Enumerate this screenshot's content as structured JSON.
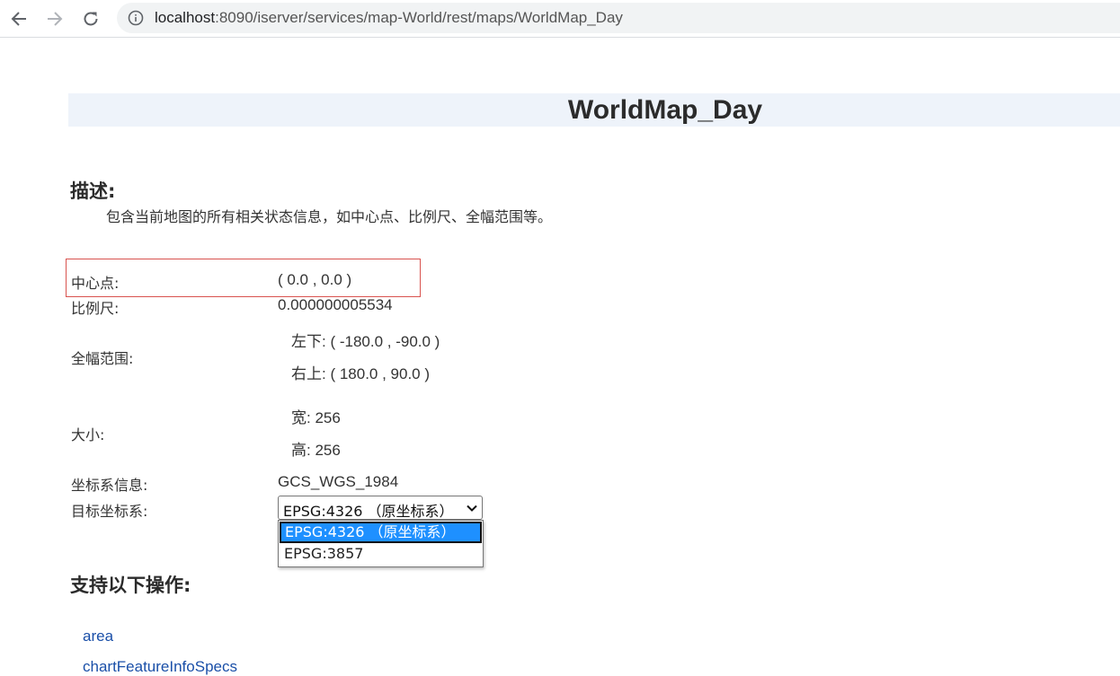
{
  "browser": {
    "url_host": "localhost",
    "url_path": ":8090/iserver/services/map-World/rest/maps/WorldMap_Day"
  },
  "page": {
    "title": "WorldMap_Day",
    "description_heading": "描述:",
    "description_text": "包含当前地图的所有相关状态信息，如中心点、比例尺、全幅范围等。"
  },
  "properties": {
    "center_label": "中心点:",
    "center_value": "( 0.0 , 0.0 )",
    "scale_label": "比例尺:",
    "scale_value": "0.000000005534",
    "bounds_label": "全幅范围:",
    "bounds_lower_left": "左下: ( -180.0 , -90.0 )",
    "bounds_upper_right": "右上: ( 180.0 , 90.0 )",
    "size_label": "大小:",
    "size_width": "宽: 256",
    "size_height": "高: 256",
    "crs_label": "坐标系信息:",
    "crs_value": "GCS_WGS_1984",
    "target_crs_label": "目标坐标系:"
  },
  "target_crs_select": {
    "selected": "EPSG:4326 （原坐标系）",
    "options": [
      "EPSG:4326 （原坐标系）",
      "EPSG:3857"
    ]
  },
  "operations": {
    "heading": "支持以下操作:",
    "links": [
      "area",
      "chartFeatureInfoSpecs"
    ]
  },
  "colors": {
    "title_band": "#eef3fa",
    "highlight_border": "#d9534f",
    "link": "#1a4fa8",
    "selected_option": "#1e90ff"
  }
}
